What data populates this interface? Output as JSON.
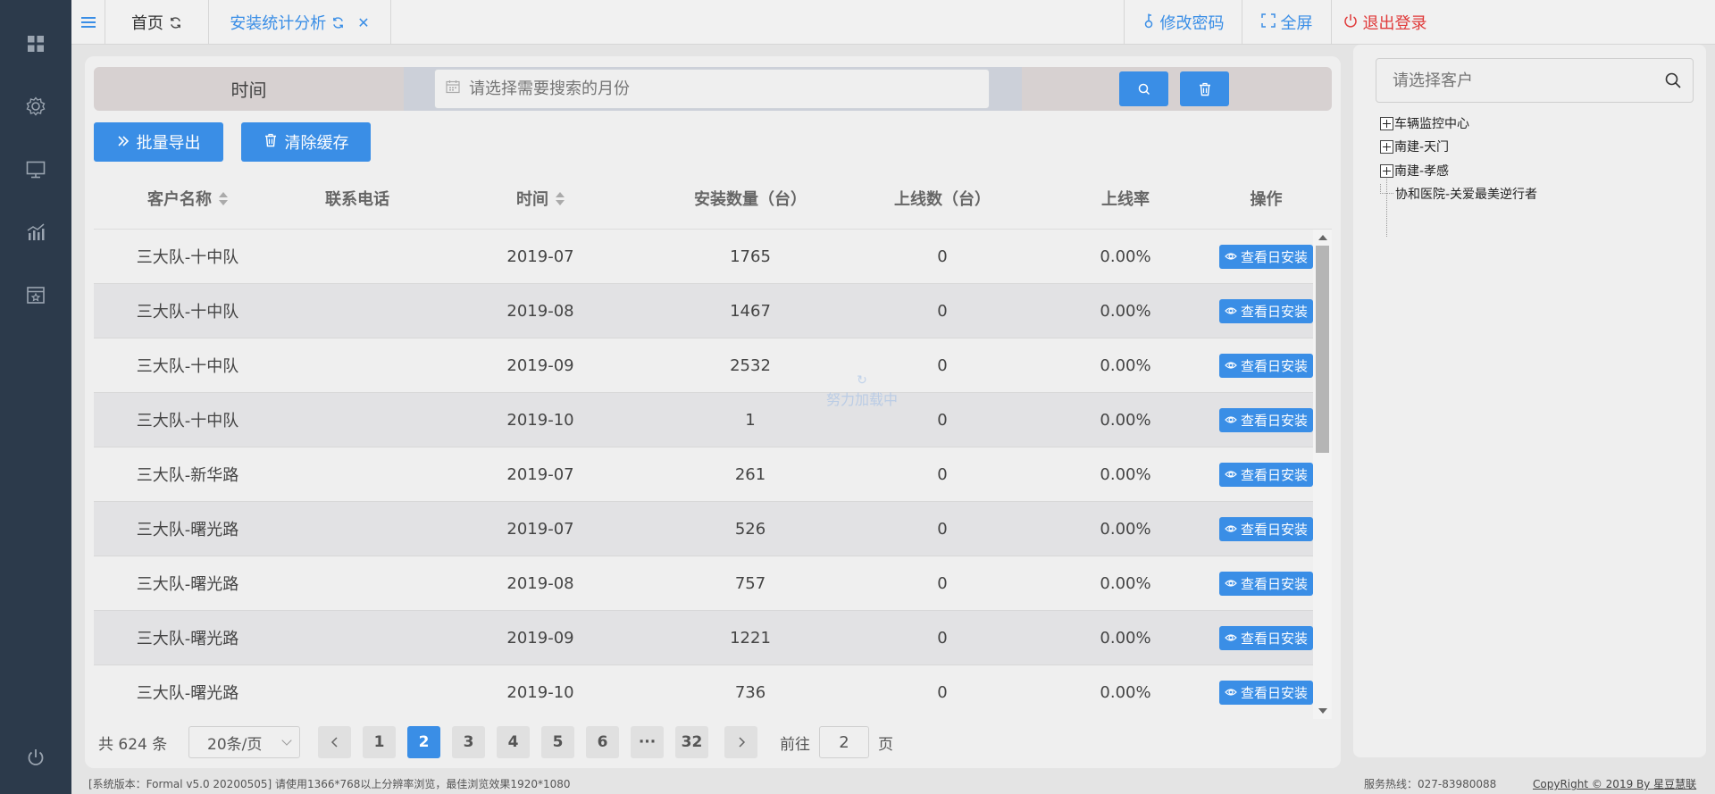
{
  "sidebar": {
    "icons": [
      "grid-icon",
      "settings-gear-icon",
      "monitor-icon",
      "analytics-chart-icon",
      "calendar-star-icon",
      "power-icon"
    ]
  },
  "header": {
    "tabs": [
      {
        "label": "首页",
        "active": false
      },
      {
        "label": "安装统计分析",
        "active": true
      }
    ],
    "change_password": "修改密码",
    "fullscreen": "全屏",
    "logout": "退出登录"
  },
  "search": {
    "time_label": "时间",
    "month_placeholder": "请选择需要搜索的月份"
  },
  "actions": {
    "export_label": "批量导出",
    "clear_cache_label": "清除缓存"
  },
  "table": {
    "columns": [
      "客户名称",
      "联系电话",
      "时间",
      "安装数量（台）",
      "上线数（台）",
      "上线率",
      "操作"
    ],
    "view_button_label": "查看日安装",
    "rows": [
      {
        "customer": "三大队-十中队",
        "phone": "",
        "time": "2019-07",
        "installs": "1765",
        "online": "0",
        "rate": "0.00%"
      },
      {
        "customer": "三大队-十中队",
        "phone": "",
        "time": "2019-08",
        "installs": "1467",
        "online": "0",
        "rate": "0.00%"
      },
      {
        "customer": "三大队-十中队",
        "phone": "",
        "time": "2019-09",
        "installs": "2532",
        "online": "0",
        "rate": "0.00%"
      },
      {
        "customer": "三大队-十中队",
        "phone": "",
        "time": "2019-10",
        "installs": "1",
        "online": "0",
        "rate": "0.00%"
      },
      {
        "customer": "三大队-新华路",
        "phone": "",
        "time": "2019-07",
        "installs": "261",
        "online": "0",
        "rate": "0.00%"
      },
      {
        "customer": "三大队-曙光路",
        "phone": "",
        "time": "2019-07",
        "installs": "526",
        "online": "0",
        "rate": "0.00%"
      },
      {
        "customer": "三大队-曙光路",
        "phone": "",
        "time": "2019-08",
        "installs": "757",
        "online": "0",
        "rate": "0.00%"
      },
      {
        "customer": "三大队-曙光路",
        "phone": "",
        "time": "2019-09",
        "installs": "1221",
        "online": "0",
        "rate": "0.00%"
      },
      {
        "customer": "三大队-曙光路",
        "phone": "",
        "time": "2019-10",
        "installs": "736",
        "online": "0",
        "rate": "0.00%"
      }
    ],
    "loading_text": "努力加载中"
  },
  "pagination": {
    "total": "共 624 条",
    "page_size": "20条/页",
    "pages": [
      "1",
      "2",
      "3",
      "4",
      "5",
      "6",
      "···",
      "32"
    ],
    "current": "2",
    "goto_prefix": "前往",
    "goto_value": "2",
    "goto_suffix": "页"
  },
  "tree": {
    "search_placeholder": "请选择客户",
    "nodes": [
      {
        "label": "车辆监控中心",
        "expandable": true
      },
      {
        "label": "南建-天门",
        "expandable": true
      },
      {
        "label": "南建-孝感",
        "expandable": true
      },
      {
        "label": "协和医院-关爱最美逆行者",
        "expandable": false
      }
    ]
  },
  "footer": {
    "version": "[系统版本：Formal v5.0 20200505] 请使用1366*768以上分辨率浏览，最佳浏览效果1920*1080",
    "hotline": "服务热线：027-83980088",
    "copyright": "CopyRight © 2019 By 星豆慧联"
  },
  "colors": {
    "accent": "#3a8ee6",
    "danger": "#e03a3a",
    "rail": "#2c3a4b"
  }
}
